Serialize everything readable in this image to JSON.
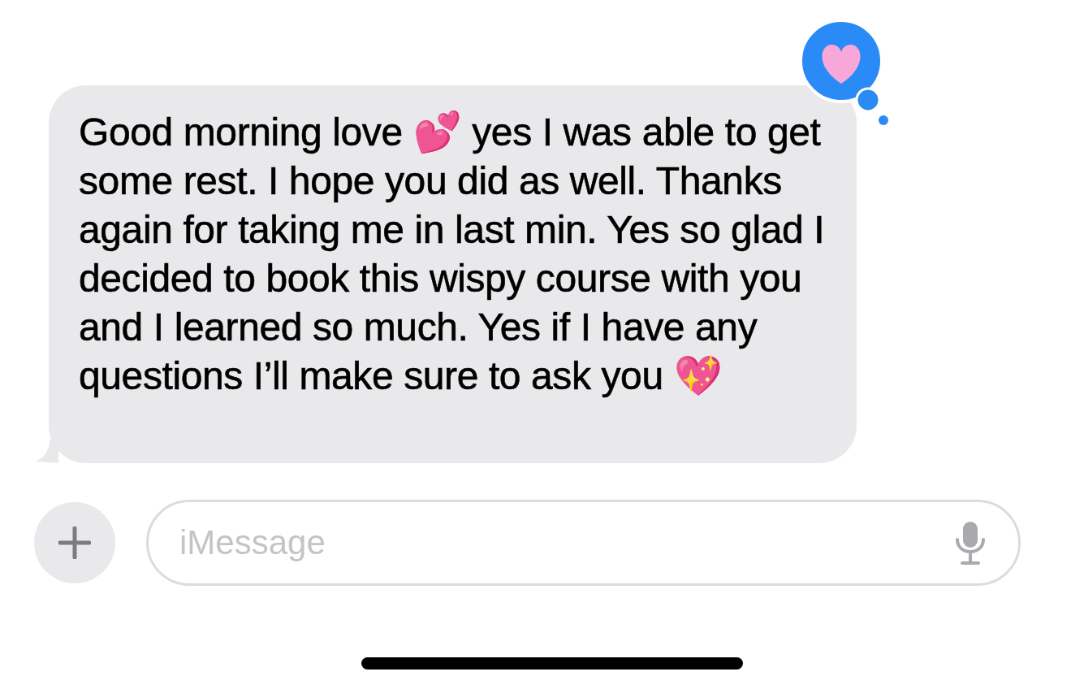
{
  "message": {
    "text": "Good morning love 💕 yes I was able to get some rest. I hope you did as well. Thanks again for taking me in last min. Yes so glad I decided to book this wispy course with you and I learned so much. Yes if I have any questions I’ll make sure to ask you 💖",
    "reaction": {
      "kind": "heart"
    }
  },
  "composer": {
    "placeholder": "iMessage"
  }
}
